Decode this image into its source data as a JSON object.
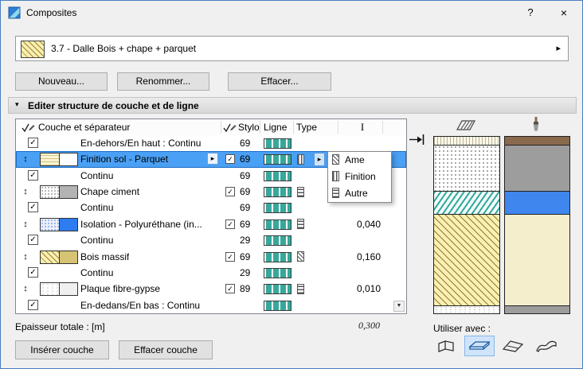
{
  "window": {
    "title": "Composites"
  },
  "icons": {
    "help": "?",
    "close": "×",
    "flyout": "▸",
    "collapse": "▾",
    "drag": "↕",
    "check": "✓",
    "scroll_down": "▼",
    "thickness_header": "I"
  },
  "selector": {
    "label": "3.7 - Dalle Bois + chape + parquet"
  },
  "actions": {
    "new": "Nouveau...",
    "rename": "Renommer...",
    "delete": "Effacer..."
  },
  "panel": {
    "title": "Editer structure de couche et de ligne"
  },
  "table": {
    "headers": {
      "layer": "Couche et séparateur",
      "pen": "Stylo",
      "line": "Ligne",
      "type": "Type"
    },
    "rows": [
      {
        "kind": "separator",
        "name": "En-dehors/En haut : Continu",
        "pen": "69"
      },
      {
        "kind": "layer",
        "selected": true,
        "name": "Finition sol - Parquet",
        "pen": "69",
        "thickness": ""
      },
      {
        "kind": "separator",
        "name": "Continu",
        "pen": "69"
      },
      {
        "kind": "layer",
        "name": "Chape ciment",
        "pen": "69",
        "thickness": ""
      },
      {
        "kind": "separator",
        "name": "Continu",
        "pen": "69"
      },
      {
        "kind": "layer",
        "name": "Isolation - Polyuréthane (in...",
        "pen": "69",
        "thickness": "0,040"
      },
      {
        "kind": "separator",
        "name": "Continu",
        "pen": "29"
      },
      {
        "kind": "layer",
        "name": "Bois massif",
        "pen": "69",
        "thickness": "0,160"
      },
      {
        "kind": "separator",
        "name": "Continu",
        "pen": "29"
      },
      {
        "kind": "layer",
        "name": "Plaque fibre-gypse",
        "pen": "89",
        "thickness": "0,010"
      },
      {
        "kind": "separator",
        "name": "En-dedans/En bas : Continu",
        "pen": ""
      }
    ]
  },
  "type_menu": {
    "items": [
      {
        "label": "Ame"
      },
      {
        "label": "Finition"
      },
      {
        "label": "Autre"
      }
    ]
  },
  "footer": {
    "total_label": "Epaisseur totale :  [m]",
    "total_value": "0,300",
    "insert_layer": "Insérer couche",
    "delete_layer": "Effacer couche"
  },
  "preview": {
    "use_with_label": "Utiliser avec :"
  },
  "colors": {
    "selection": "#4aa0f4",
    "accent": "#2e7cf0",
    "line_swatch": "#37a89b"
  }
}
